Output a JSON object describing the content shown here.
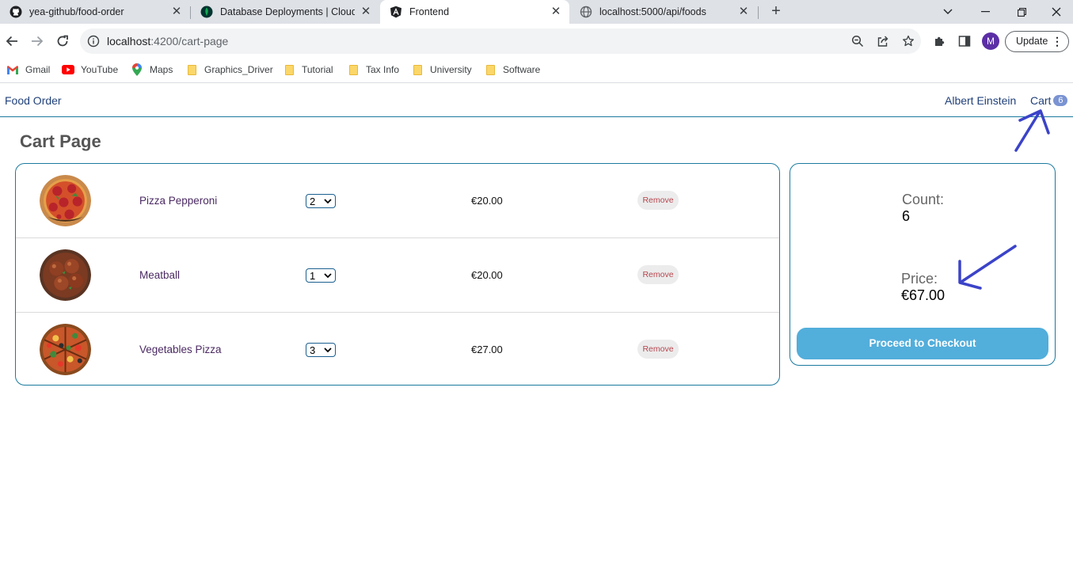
{
  "browser": {
    "tabs": [
      {
        "label": "yea-github/food-order",
        "icon": "github-icon",
        "active": false
      },
      {
        "label": "Database Deployments | Cloud: M",
        "icon": "mongodb-leaf-icon",
        "active": false
      },
      {
        "label": "Frontend",
        "icon": "angular-icon",
        "active": true
      },
      {
        "label": "localhost:5000/api/foods",
        "icon": "globe-icon",
        "active": false
      }
    ],
    "address": {
      "host": "localhost",
      "path": ":4200/cart-page"
    },
    "profile_initial": "M",
    "update_label": "Update",
    "bookmarks": [
      {
        "label": "Gmail",
        "icon": "gmail-icon"
      },
      {
        "label": "YouTube",
        "icon": "youtube-icon"
      },
      {
        "label": "Maps",
        "icon": "maps-icon"
      },
      {
        "label": "Graphics_Driver",
        "icon": "folder-icon"
      },
      {
        "label": "Tutorial",
        "icon": "folder-icon"
      },
      {
        "label": "Tax Info",
        "icon": "folder-icon"
      },
      {
        "label": "University",
        "icon": "folder-icon"
      },
      {
        "label": "Software",
        "icon": "folder-icon"
      }
    ]
  },
  "header": {
    "brand": "Food Order",
    "user": "Albert Einstein",
    "cart_label": "Cart",
    "cart_count": "6"
  },
  "page": {
    "title": "Cart Page",
    "items": [
      {
        "name": "Pizza Pepperoni",
        "quantity": "2",
        "price": "€20.00",
        "remove": "Remove",
        "image": "pizza-pepperoni-image"
      },
      {
        "name": "Meatball",
        "quantity": "1",
        "price": "€20.00",
        "remove": "Remove",
        "image": "meatball-image"
      },
      {
        "name": "Vegetables Pizza",
        "quantity": "3",
        "price": "€27.00",
        "remove": "Remove",
        "image": "vegetables-pizza-image"
      }
    ],
    "summary": {
      "count_label": "Count:",
      "count_value": "6",
      "price_label": "Price:",
      "price_value": "€67.00",
      "checkout_label": "Proceed to Checkout"
    }
  },
  "colors": {
    "accent_border": "#1b7a9f",
    "link": "#21417a",
    "checkout_button": "#52aedb",
    "annotation_ink": "#3b43c9"
  }
}
